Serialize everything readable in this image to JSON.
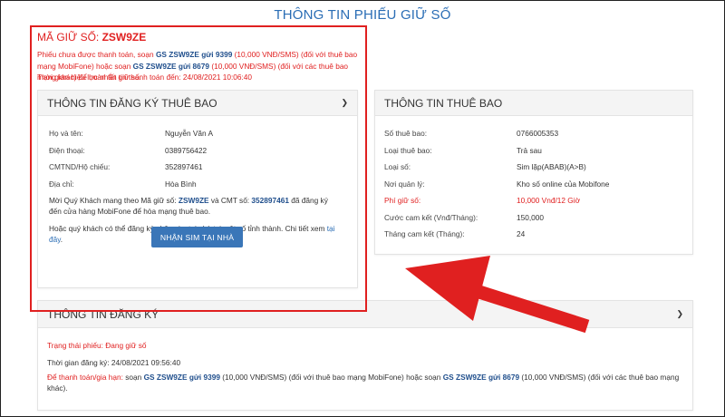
{
  "page_title": "THÔNG TIN PHIẾU GIỮ SỐ",
  "hold": {
    "code_label": "MÃ GIỮ SỐ: ",
    "code_value": "ZSW9ZE",
    "note_1": "Phiếu chưa được thanh toán, soạn ",
    "note_cmd_1": "GS ZSW9ZE gửi 9399",
    "note_2": " (10,000 VNĐ/SMS) (đối với thuê bao mạng MobiFone) hoặc soạn ",
    "note_cmd_2": "GS ZSW9ZE gửi 8679",
    "note_3": " (10,000 VNĐ/SMS) (đối với các thuê bao mạng khác) để hoàn tất giữ số.",
    "expiry": "Thời gian hiệu lực nhắn tin thanh toán đến: 24/08/2021 10:06:40"
  },
  "registration_panel": {
    "title": "THÔNG TIN ĐĂNG KÝ THUÊ BAO",
    "rows": [
      {
        "label": "Họ và tên:",
        "value": "Nguyễn Văn A"
      },
      {
        "label": "Điện thoại:",
        "value": "0389756422"
      },
      {
        "label": "CMTND/Hộ chiếu:",
        "value": "352897461"
      },
      {
        "label": "Địa chỉ:",
        "value": "Hòa Bình"
      }
    ],
    "invite_1": "Mời Quý Khách mang theo Mã giữ số: ",
    "invite_code": "ZSW9ZE",
    "invite_2": " và CMT số: ",
    "invite_id": "352897461",
    "invite_3": " đã đăng ký đến cửa hàng MobiFone để hòa mạng thuê bao.",
    "home_1": "Hoặc quý khách có thể đăng ký nhận sim tại nhà tại một số tỉnh thành. Chi tiết xem ",
    "home_link": "tại đây",
    "home_2": ".",
    "button_label": "NHẬN SIM TẠI NHÀ"
  },
  "subscriber_panel": {
    "title": "THÔNG TIN THUÊ BAO",
    "rows": [
      {
        "label": "Số thuê bao:",
        "value": "0766005353"
      },
      {
        "label": "Loại thuê bao:",
        "value": "Trả sau"
      },
      {
        "label": "Loại số:",
        "value": "Sim lặp(ABAB)(A>B)"
      },
      {
        "label": "Nơi quản lý:",
        "value": "Kho số online của Mobifone"
      },
      {
        "label": "Phí giữ số:",
        "value": "10,000 Vnđ/12 Giờ"
      },
      {
        "label": "Cước cam kết (Vnđ/Tháng):",
        "value": "150,000"
      },
      {
        "label": "Tháng cam kết (Tháng):",
        "value": "24"
      }
    ]
  },
  "signup_panel": {
    "title": "THÔNG TIN ĐĂNG KÝ",
    "status": "Trạng thái phiếu: Đang giữ số",
    "signup_time": "Thời gian đăng ký: 24/08/2021 09:56:40",
    "pay_label": "Để thanh toán/gia hạn:",
    "pay_1": " soạn ",
    "pay_cmd_1": "GS ZSW9ZE gửi 9399",
    "pay_2": " (10,000 VNĐ/SMS) (đối với thuê bao mạng MobiFone) hoặc soạn ",
    "pay_cmd_2": "GS ZSW9ZE gửi 8679",
    "pay_3": " (10,000 VNĐ/SMS) (đối với các thuê bao mạng khác)."
  },
  "colors": {
    "accent_blue": "#2a6db5",
    "alert_red": "#e02020",
    "button_blue": "#3a76b8"
  }
}
